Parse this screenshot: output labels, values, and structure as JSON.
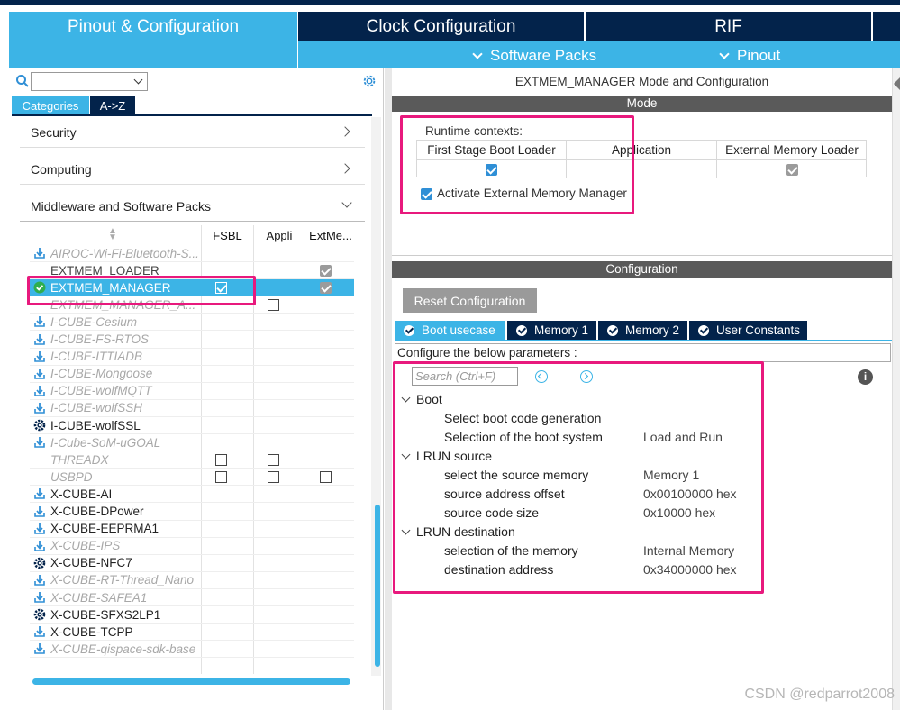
{
  "top_tabs": [
    "Pinout & Configuration",
    "Clock Configuration",
    "RIF"
  ],
  "sub_menu": [
    "Software Packs",
    "Pinout"
  ],
  "left": {
    "category_tabs": [
      "Categories",
      "A->Z"
    ],
    "categories": [
      "Security",
      "Computing",
      "Middleware and Software Packs"
    ],
    "columns": [
      "FSBL",
      "Appli",
      "ExtMe..."
    ],
    "items": [
      {
        "name": "AIROC-Wi-Fi-Bluetooth-S...",
        "style": "gray-italic",
        "icon": "download-icon"
      },
      {
        "name": "EXTMEM_LOADER",
        "style": "plain",
        "icon": ""
      },
      {
        "name": "EXTMEM_MANAGER",
        "style": "selected",
        "icon": "check-circle-icon"
      },
      {
        "name": "EXTMEM_MANAGER_A...",
        "style": "gray-italic",
        "icon": ""
      },
      {
        "name": "I-CUBE-Cesium",
        "style": "gray-italic",
        "icon": "download-icon"
      },
      {
        "name": "I-CUBE-FS-RTOS",
        "style": "gray-italic",
        "icon": "download-icon"
      },
      {
        "name": "I-CUBE-ITTIADB",
        "style": "gray-italic",
        "icon": "download-icon"
      },
      {
        "name": "I-CUBE-Mongoose",
        "style": "gray-italic",
        "icon": "download-icon"
      },
      {
        "name": "I-CUBE-wolfMQTT",
        "style": "gray-italic",
        "icon": "download-icon"
      },
      {
        "name": "I-CUBE-wolfSSH",
        "style": "gray-italic",
        "icon": "download-icon"
      },
      {
        "name": "I-CUBE-wolfSSL",
        "style": "dark",
        "icon": "gear-icon"
      },
      {
        "name": "I-Cube-SoM-uGOAL",
        "style": "gray-italic",
        "icon": "download-icon"
      },
      {
        "name": "THREADX",
        "style": "gray-italic",
        "icon": ""
      },
      {
        "name": "USBPD",
        "style": "gray-italic",
        "icon": ""
      },
      {
        "name": "X-CUBE-AI",
        "style": "dark",
        "icon": "download-icon"
      },
      {
        "name": "X-CUBE-DPower",
        "style": "dark",
        "icon": "download-icon"
      },
      {
        "name": "X-CUBE-EEPRMA1",
        "style": "dark",
        "icon": "download-icon"
      },
      {
        "name": "X-CUBE-IPS",
        "style": "gray-italic",
        "icon": "download-icon"
      },
      {
        "name": "X-CUBE-NFC7",
        "style": "dark",
        "icon": "gear-icon"
      },
      {
        "name": "X-CUBE-RT-Thread_Nano",
        "style": "gray-italic",
        "icon": "download-icon"
      },
      {
        "name": "X-CUBE-SAFEA1",
        "style": "gray-italic",
        "icon": "download-icon"
      },
      {
        "name": "X-CUBE-SFXS2LP1",
        "style": "dark",
        "icon": "gear-icon"
      },
      {
        "name": "X-CUBE-TCPP",
        "style": "dark",
        "icon": "download-icon"
      },
      {
        "name": "X-CUBE-qispace-sdk-base",
        "style": "gray-italic",
        "icon": "download-icon"
      }
    ]
  },
  "right": {
    "title": "EXTMEM_MANAGER Mode and Configuration",
    "mode_label": "Mode",
    "runtime_label": "Runtime contexts:",
    "contexts": [
      "First Stage Boot Loader",
      "Application",
      "External Memory Loader"
    ],
    "activate_label": "Activate External Memory Manager",
    "config_label": "Configuration",
    "reset_label": "Reset Configuration",
    "config_tabs": [
      "Boot usecase",
      "Memory 1",
      "Memory 2",
      "User Constants"
    ],
    "hint": "Configure the below parameters :",
    "search_placeholder": "Search (Ctrl+F)",
    "groups": [
      {
        "name": "Boot",
        "params": [
          {
            "label": "Select boot code generation",
            "value": ""
          },
          {
            "label": "Selection of the boot system",
            "value": "Load and Run"
          }
        ]
      },
      {
        "name": "LRUN source",
        "params": [
          {
            "label": "select the source memory",
            "value": "Memory 1"
          },
          {
            "label": "source address offset",
            "value": "0x00100000 hex"
          },
          {
            "label": "source code size",
            "value": "0x10000 hex"
          }
        ]
      },
      {
        "name": "LRUN destination",
        "params": [
          {
            "label": "selection of the memory",
            "value": "Internal Memory"
          },
          {
            "label": "destination address",
            "value": "0x34000000 hex"
          }
        ]
      }
    ]
  },
  "watermark": "CSDN @redparrot2008",
  "colors": {
    "accent": "#3cb4e6",
    "navy": "#03234b",
    "highlight": "#e8197d"
  }
}
